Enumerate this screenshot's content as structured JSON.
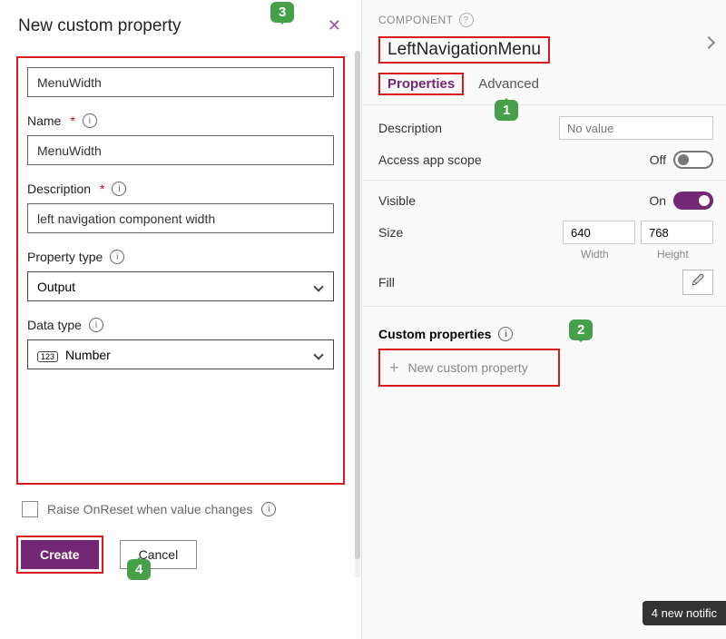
{
  "left": {
    "title": "New custom property",
    "display_name_value": "MenuWidth",
    "name_label": "Name",
    "name_value": "MenuWidth",
    "desc_label": "Description",
    "desc_value": "left navigation component width",
    "ptype_label": "Property type",
    "ptype_value": "Output",
    "dtype_label": "Data type",
    "dtype_value": "Number",
    "reset_label": "Raise OnReset when value changes",
    "create": "Create",
    "cancel": "Cancel"
  },
  "right": {
    "head": "COMPONENT",
    "comp_name": "LeftNavigationMenu",
    "tab_props": "Properties",
    "tab_adv": "Advanced",
    "desc_label": "Description",
    "desc_placeholder": "No value",
    "scope_label": "Access app scope",
    "scope_state": "Off",
    "visible_label": "Visible",
    "visible_state": "On",
    "size_label": "Size",
    "size_w": "640",
    "size_h": "768",
    "w_cap": "Width",
    "h_cap": "Height",
    "fill_label": "Fill",
    "custom_h": "Custom properties",
    "new_prop": "New custom property"
  },
  "callouts": {
    "c1": "1",
    "c2": "2",
    "c3": "3",
    "c4": "4"
  },
  "notif": "4 new notific"
}
